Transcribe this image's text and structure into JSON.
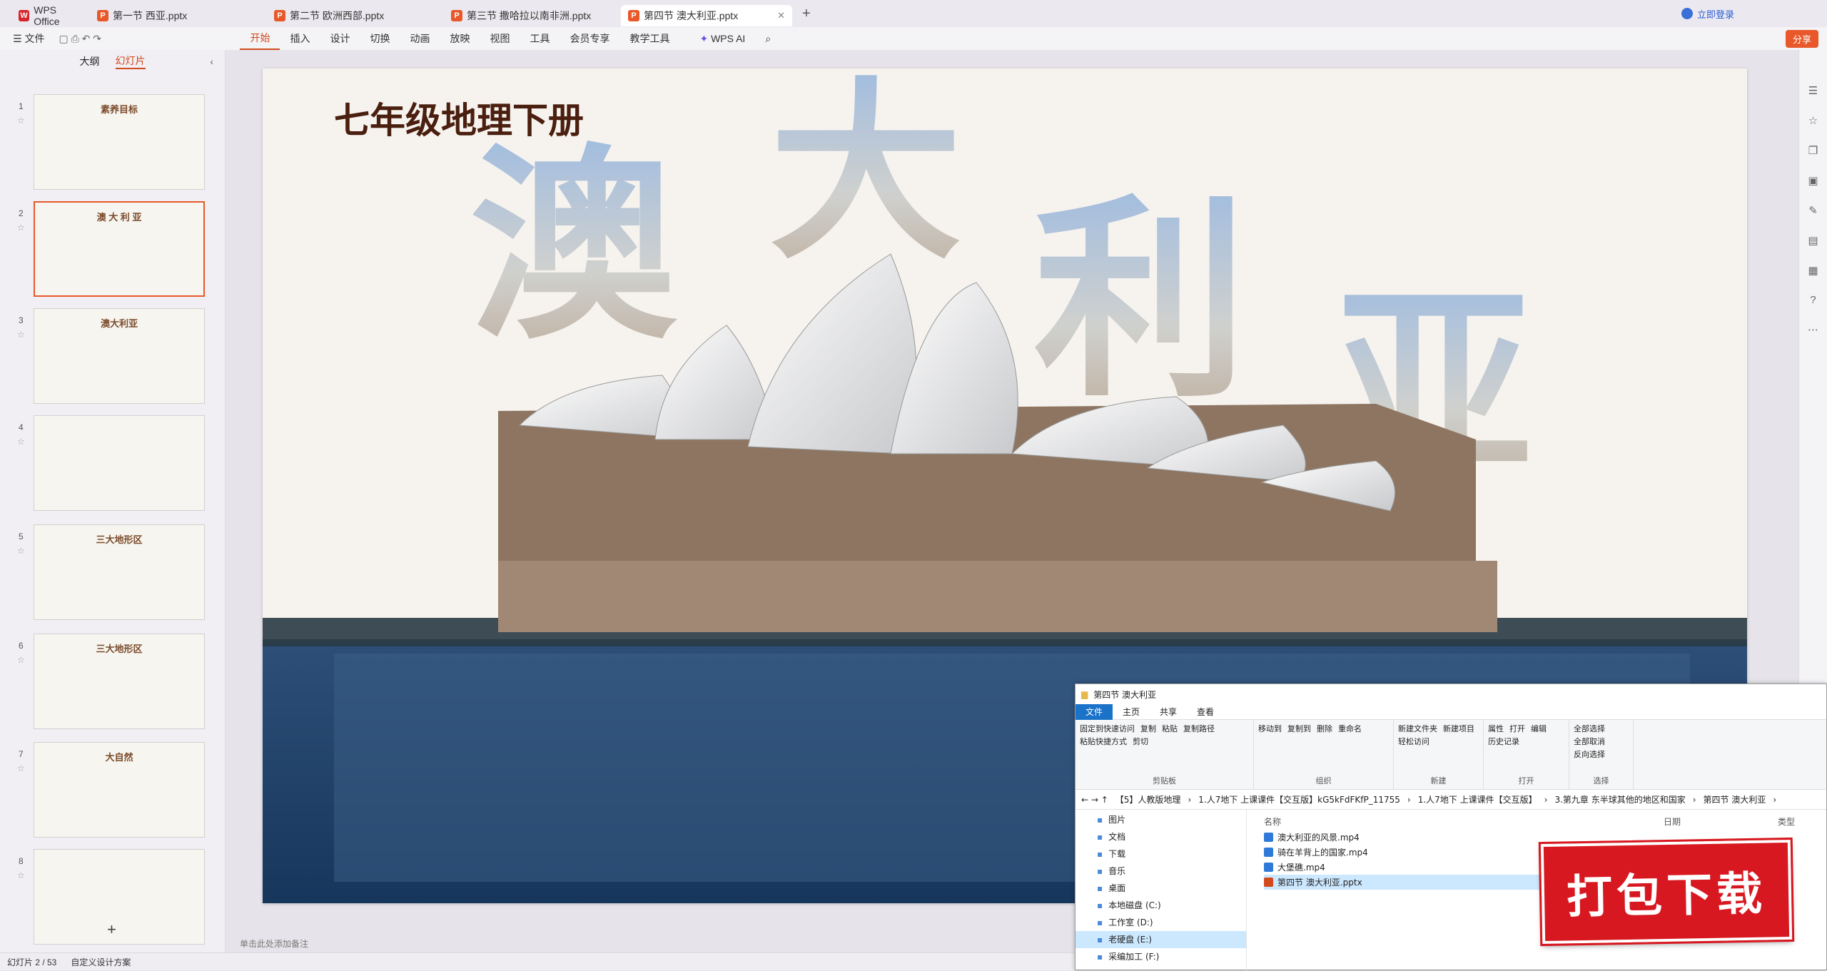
{
  "tabs": [
    {
      "label": "WPS Office",
      "icon": "wps-logo"
    },
    {
      "label": "第一节 西亚.pptx",
      "icon": "ppt-icon"
    },
    {
      "label": "第二节 欧洲西部.pptx",
      "icon": "ppt-icon"
    },
    {
      "label": "第三节 撒哈拉以南非洲.pptx",
      "icon": "ppt-icon"
    },
    {
      "label": "第四节 澳大利亚.pptx",
      "icon": "ppt-icon"
    }
  ],
  "header": {
    "login": "立即登录",
    "share": "分享"
  },
  "menu": {
    "file": "文件",
    "items": [
      "开始",
      "插入",
      "设计",
      "切换",
      "动画",
      "放映",
      "视图",
      "工具",
      "会员专享",
      "教学工具"
    ],
    "ai": "WPS AI"
  },
  "left": {
    "outline": "大纲",
    "slides": "幻灯片"
  },
  "thumbs": [
    {
      "n": "1",
      "text": "素养目标"
    },
    {
      "n": "2",
      "text": "澳 大 利 亚"
    },
    {
      "n": "3",
      "text": "澳大利亚"
    },
    {
      "n": "4",
      "text": ""
    },
    {
      "n": "5",
      "text": "三大地形区"
    },
    {
      "n": "6",
      "text": "三大地形区"
    },
    {
      "n": "7",
      "text": "大自然"
    },
    {
      "n": "8",
      "text": ""
    }
  ],
  "slide": {
    "subtitle": "七年级地理下册",
    "big": [
      "澳",
      "大",
      "利",
      "亚"
    ]
  },
  "notes": "单击此处添加备注",
  "status": {
    "page": "幻灯片 2 / 53",
    "design": "自定义设计方案"
  },
  "explorer": {
    "title": "第四节 澳大利亚",
    "tabs": [
      "文件",
      "主页",
      "共享",
      "查看"
    ],
    "groups": [
      {
        "label": "剪贴板",
        "items": [
          "固定到快速访问",
          "复制",
          "粘贴",
          "复制路径",
          "粘贴快捷方式",
          "剪切"
        ]
      },
      {
        "label": "组织",
        "items": [
          "移动到",
          "复制到",
          "删除",
          "重命名"
        ]
      },
      {
        "label": "新建",
        "items": [
          "新建文件夹",
          "新建项目",
          "轻松访问"
        ]
      },
      {
        "label": "打开",
        "items": [
          "属性",
          "打开",
          "编辑",
          "历史记录"
        ]
      },
      {
        "label": "选择",
        "items": [
          "全部选择",
          "全部取消",
          "反向选择"
        ]
      }
    ],
    "address": [
      "【5】人教版地理",
      "1.人7地下 上课课件【交互版】kG5kFdFKfP_11755",
      "1.人7地下 上课课件【交互版】",
      "3.第九章 东半球其他的地区和国家",
      "第四节 澳大利亚"
    ],
    "nav": [
      "图片",
      "文档",
      "下载",
      "音乐",
      "桌面",
      "本地磁盘 (C:)",
      "工作室 (D:)",
      "老硬盘 (E:)",
      "采编加工 (F:)"
    ],
    "columns": [
      "名称",
      "日期",
      "类型"
    ],
    "files": [
      "澳大利亚的风景.mp4",
      "骑在羊背上的国家.mp4",
      "大堡礁.mp4",
      "第四节 澳大利亚.pptx"
    ]
  },
  "stamp": "打包下载"
}
